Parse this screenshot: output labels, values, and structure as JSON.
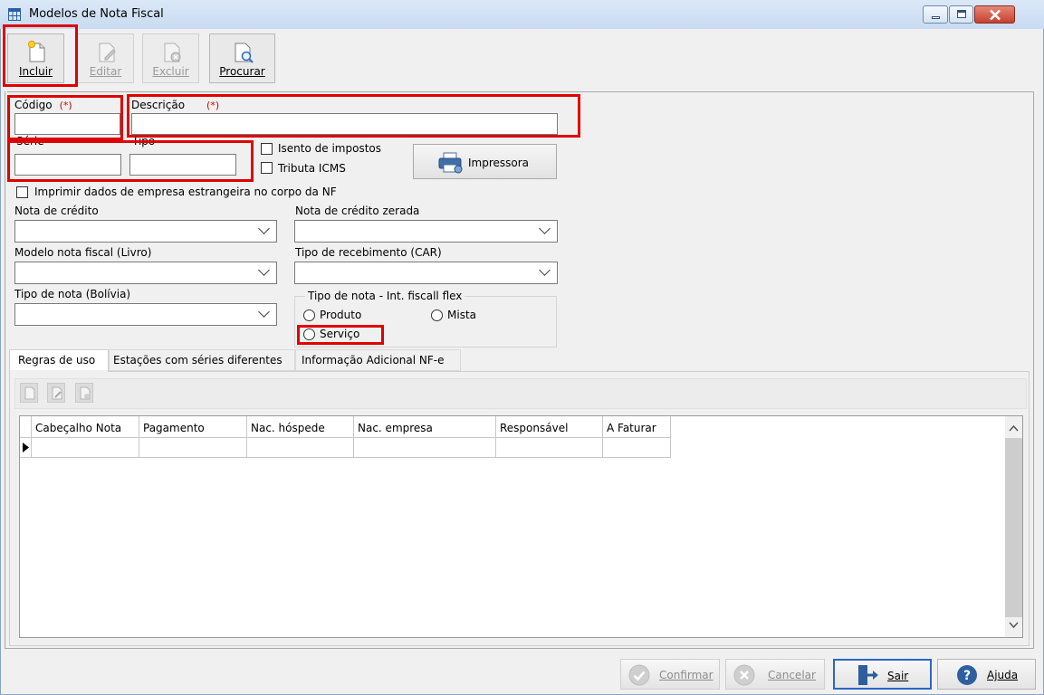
{
  "window": {
    "title": "Modelos de Nota Fiscal",
    "icon": "table-icon"
  },
  "toolbar": {
    "incluir": "Incluir",
    "editar": "Editar",
    "excluir": "Excluir",
    "procurar": "Procurar"
  },
  "form": {
    "codigo_label": "Código",
    "descricao_label": "Descrição",
    "required_mark": "(*)",
    "serie_label": "Série",
    "tipo_label": "Tipo",
    "isento_label": "Isento de impostos",
    "tributa_label": "Tributa ICMS",
    "impressora_label": "Impressora",
    "imprimir_label": "Imprimir dados de empresa estrangeira no corpo da NF",
    "nota_credito_label": "Nota de crédito",
    "nota_credito_zerada_label": "Nota de crédito zerada",
    "modelo_livro_label": "Modelo nota fiscal (Livro)",
    "tipo_recebimento_label": "Tipo de recebimento (CAR)",
    "tipo_nota_bolivia_label": "Tipo de nota (Bolívia)",
    "flex_group_label": "Tipo de nota - Int. fiscall flex",
    "radio_produto": "Produto",
    "radio_mista": "Mista",
    "radio_servico": "Serviço"
  },
  "tabs": [
    {
      "label": "Regras de uso",
      "active": true
    },
    {
      "label": "Estações com séries diferentes",
      "active": false
    },
    {
      "label": "Informação Adicional NF-e",
      "active": false
    }
  ],
  "grid": {
    "columns": [
      "Cabeçalho Nota",
      "Pagamento",
      "Nac. hóspede",
      "Nac. empresa",
      "Responsável",
      "A Faturar"
    ]
  },
  "buttons": {
    "confirmar": "Confirmar",
    "cancelar": "Cancelar",
    "sair": "Sair",
    "ajuda": "Ajuda"
  },
  "colors": {
    "highlight": "#e00000",
    "primary_border": "#2b66c8"
  }
}
